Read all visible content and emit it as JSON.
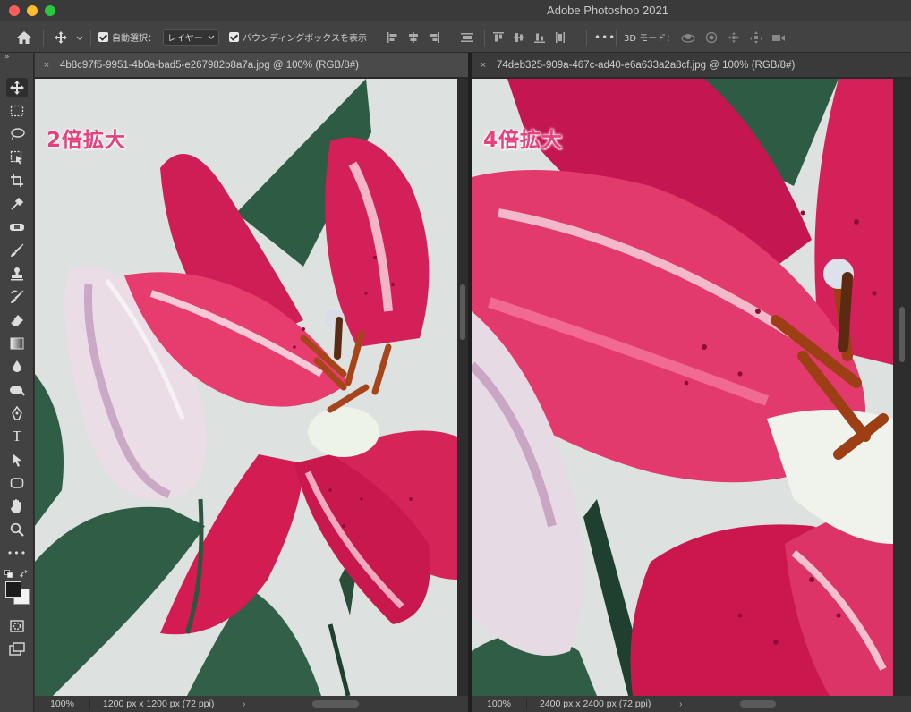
{
  "window": {
    "title": "Adobe Photoshop 2021"
  },
  "options_bar": {
    "auto_select_label": "自動選択：",
    "auto_select_target": "レイヤー",
    "show_bounding_box_label": "バウンディングボックスを表示",
    "three_d_mode_label": "3D モード："
  },
  "toolbar": {
    "collapse_glyph": "»",
    "tools": [
      "move-tool",
      "marquee-tool",
      "lasso-tool",
      "object-select-tool",
      "crop-tool",
      "eyedropper-tool",
      "healing-brush-tool",
      "brush-tool",
      "stamp-tool",
      "history-brush-tool",
      "eraser-tool",
      "gradient-tool",
      "blur-tool",
      "dodge-tool",
      "pen-tool",
      "type-tool",
      "path-select-tool",
      "shape-tool",
      "hand-tool",
      "zoom-tool",
      "more-tools",
      "color-swatches",
      "quick-mask",
      "screen-mode"
    ],
    "type_tool_glyph": "T",
    "more_glyph": "•••"
  },
  "documents": [
    {
      "tab_title": "4b8c97f5-9951-4b0a-bad5-e267982b8a7a.jpg @ 100% (RGB/8#)",
      "close_glyph": "×",
      "caption": "2倍拡大",
      "zoom": "100%",
      "info": "1200 px x 1200 px (72 ppi)",
      "arrow": "›"
    },
    {
      "tab_title": "74deb325-909a-467c-ad40-e6a633a2a8cf.jpg @ 100% (RGB/8#)",
      "close_glyph": "×",
      "caption": "4倍拡大",
      "zoom": "100%",
      "info": "2400 px x 2400 px (72 ppi)",
      "arrow": "›"
    }
  ],
  "colors": {
    "caption_pink": "#e8407d",
    "petal_pink": "#d81e5a",
    "leaf_green": "#2f5a43",
    "stamen_orange": "#a34416"
  }
}
